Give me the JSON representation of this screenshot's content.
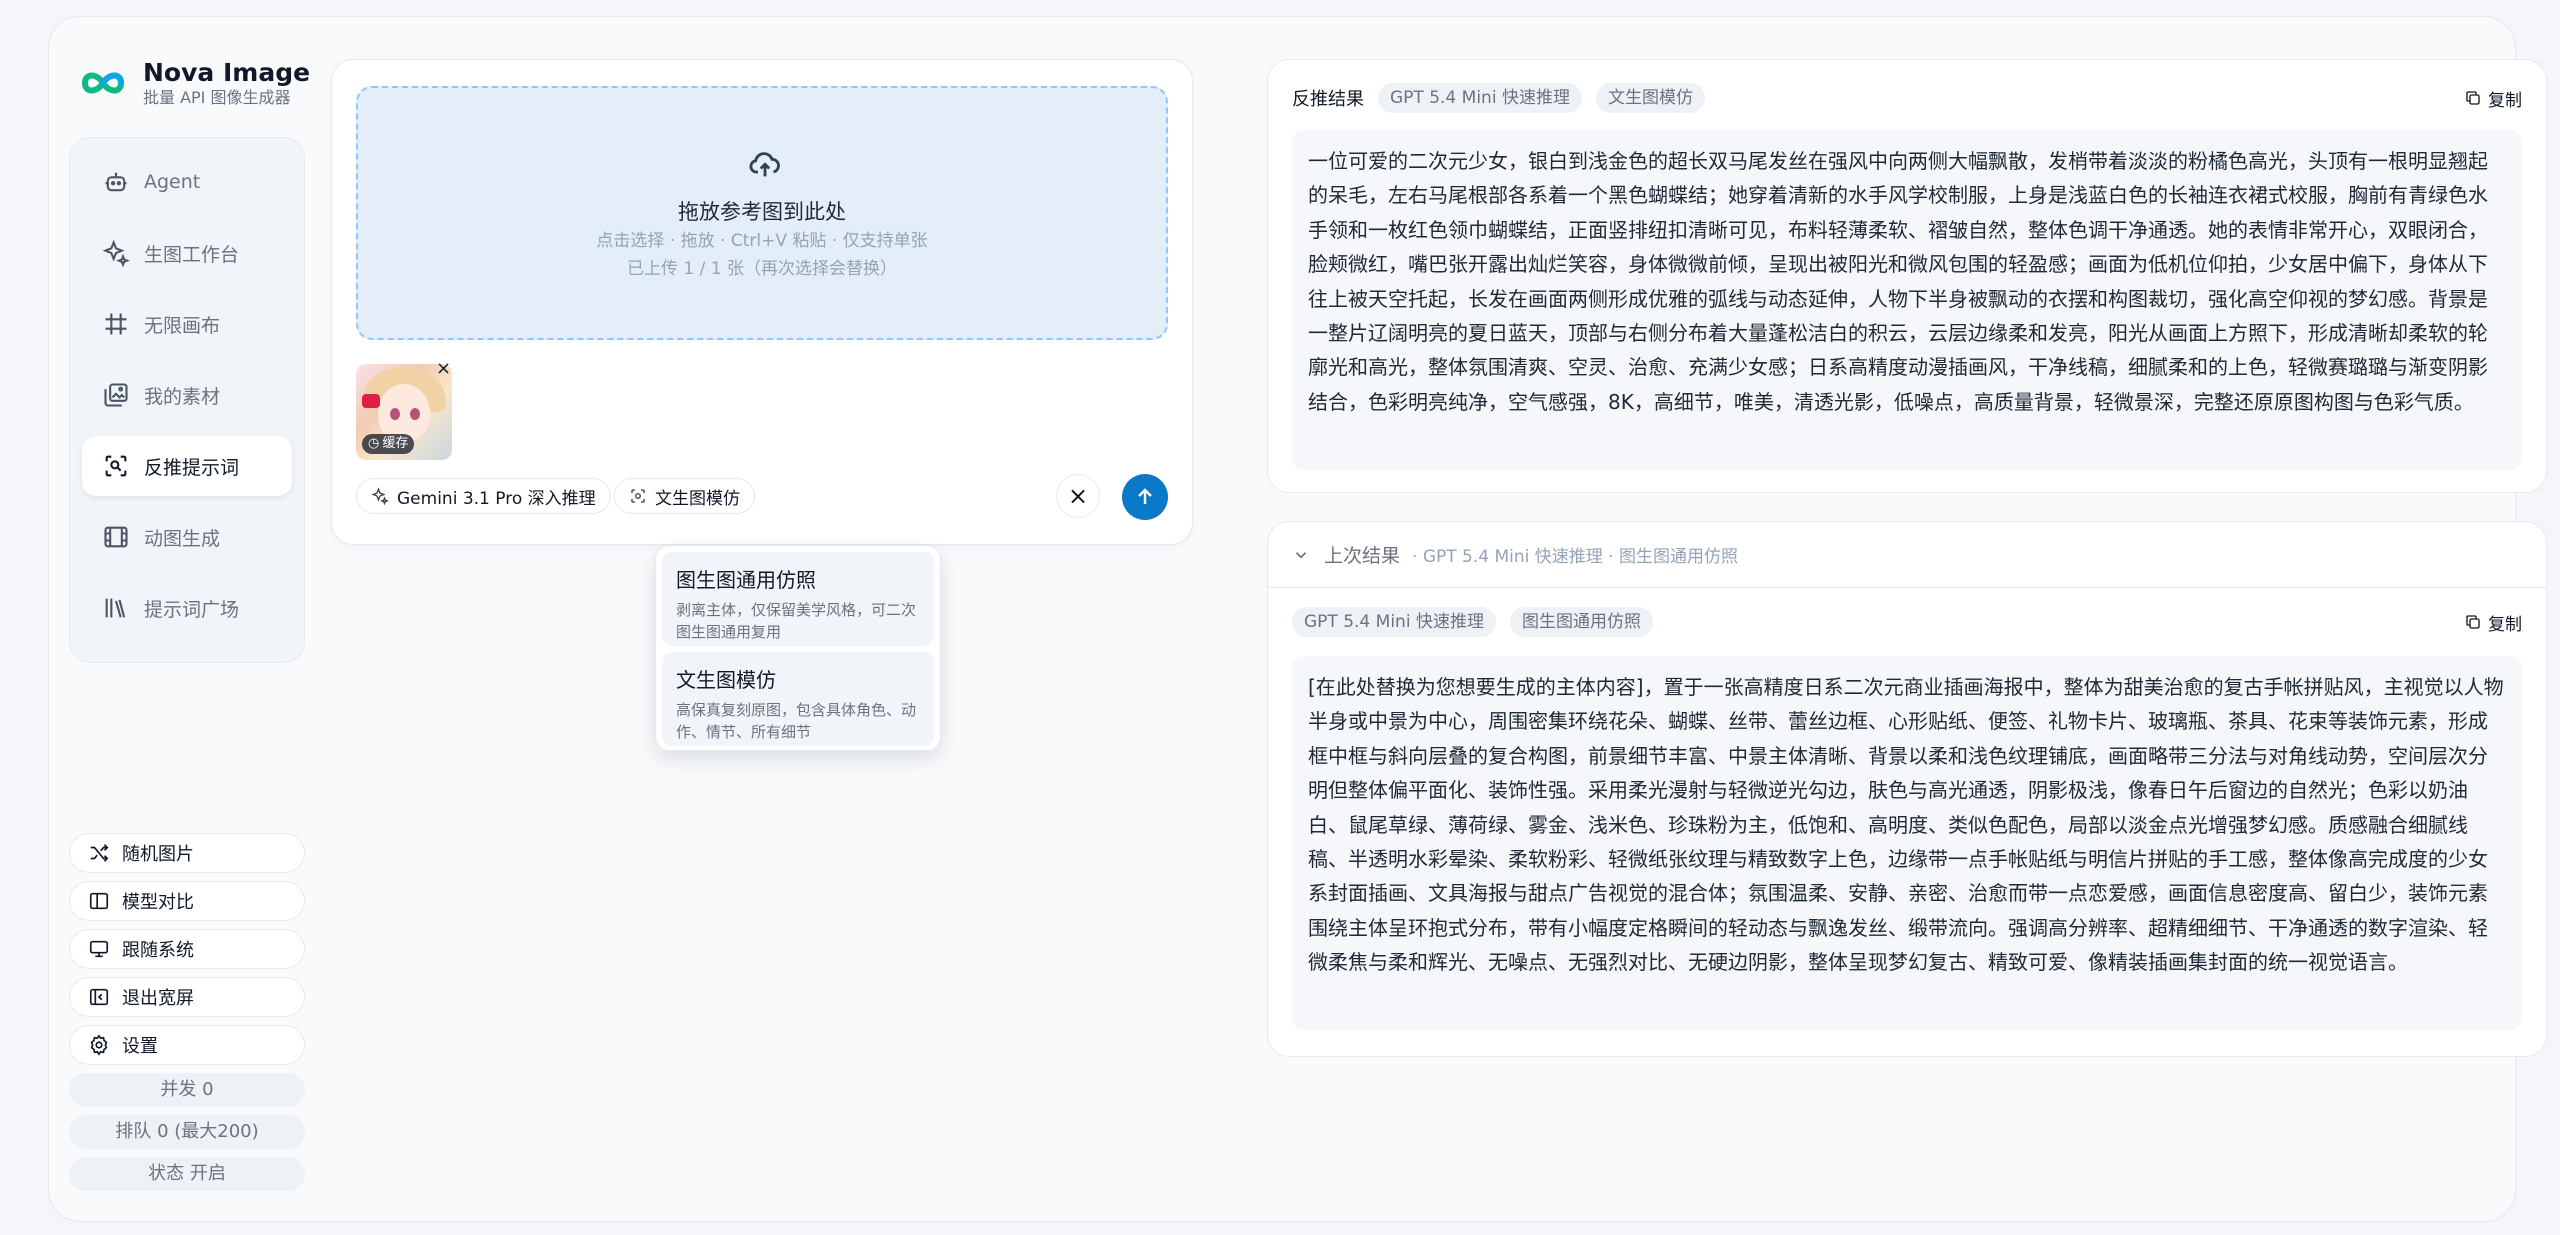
{
  "brand": {
    "name": "Nova Image",
    "subtitle": "批量 API 图像生成器"
  },
  "nav": [
    {
      "label": "Agent",
      "icon": "robot-icon"
    },
    {
      "label": "生图工作台",
      "icon": "sparkle-icon"
    },
    {
      "label": "无限画布",
      "icon": "canvas-icon"
    },
    {
      "label": "我的素材",
      "icon": "gallery-icon"
    },
    {
      "label": "反推提示词",
      "icon": "scan-icon",
      "active": true
    },
    {
      "label": "动图生成",
      "icon": "film-icon"
    },
    {
      "label": "提示词广场",
      "icon": "library-icon"
    }
  ],
  "bottom": {
    "random": "随机图片",
    "compare": "模型对比",
    "system": "跟随系统",
    "exit_wide": "退出宽屏",
    "settings": "设置"
  },
  "stats": {
    "concurrency": "并发 0",
    "queue": "排队 0 (最大200)",
    "status": "状态 开启"
  },
  "upload": {
    "title": "拖放参考图到此处",
    "hint": "点击选择 · 拖放 · Ctrl+V 粘贴 · 仅支持单张",
    "count": "已上传 1 / 1 张（再次选择会替换）",
    "thumb_badge": "缓存",
    "close_glyph": "×"
  },
  "chips": {
    "model": "Gemini 3.1 Pro 深入推理",
    "mode": "文生图模仿"
  },
  "actions": {
    "clear_glyph": "×"
  },
  "dropdown": [
    {
      "title": "图生图通用仿照",
      "desc": "剥离主体，仅保留美学风格，可二次图生图通用复用"
    },
    {
      "title": "文生图模仿",
      "desc": "高保真复刻原图，包含具体角色、动作、情节、所有细节"
    }
  ],
  "result": {
    "label": "反推结果",
    "tags": [
      "GPT 5.4 Mini 快速推理",
      "文生图模仿"
    ],
    "copy": "复制",
    "text": "一位可爱的二次元少女，银白到浅金色的超长双马尾发丝在强风中向两侧大幅飘散，发梢带着淡淡的粉橘色高光，头顶有一根明显翘起的呆毛，左右马尾根部各系着一个黑色蝴蝶结；她穿着清新的水手风学校制服，上身是浅蓝白色的长袖连衣裙式校服，胸前有青绿色水手领和一枚红色领巾蝴蝶结，正面竖排纽扣清晰可见，布料轻薄柔软、褶皱自然，整体色调干净通透。她的表情非常开心，双眼闭合，脸颊微红，嘴巴张开露出灿烂笑容，身体微微前倾，呈现出被阳光和微风包围的轻盈感；画面为低机位仰拍，少女居中偏下，身体从下往上被天空托起，长发在画面两侧形成优雅的弧线与动态延伸，人物下半身被飘动的衣摆和构图裁切，强化高空仰视的梦幻感。背景是一整片辽阔明亮的夏日蓝天，顶部与右侧分布着大量蓬松洁白的积云，云层边缘柔和发亮，阳光从画面上方照下，形成清晰却柔软的轮廓光和高光，整体氛围清爽、空灵、治愈、充满少女感；日系高精度动漫插画风，干净线稿，细腻柔和的上色，轻微赛璐璐与渐变阴影结合，色彩明亮纯净，空气感强，8K，高细节，唯美，清透光影，低噪点，高质量背景，轻微景深，完整还原原图构图与色彩气质。"
  },
  "previous": {
    "title": "上次结果",
    "meta": "· GPT 5.4 Mini 快速推理 · 图生图通用仿照",
    "tags": [
      "GPT 5.4 Mini 快速推理",
      "图生图通用仿照"
    ],
    "copy": "复制",
    "text": "[在此处替换为您想要生成的主体内容]，置于一张高精度日系二次元商业插画海报中，整体为甜美治愈的复古手帐拼贴风，主视觉以人物半身或中景为中心，周围密集环绕花朵、蝴蝶、丝带、蕾丝边框、心形贴纸、便签、礼物卡片、玻璃瓶、茶具、花束等装饰元素，形成框中框与斜向层叠的复合构图，前景细节丰富、中景主体清晰、背景以柔和浅色纹理铺底，画面略带三分法与对角线动势，空间层次分明但整体偏平面化、装饰性强。采用柔光漫射与轻微逆光勾边，肤色与高光通透，阴影极浅，像春日午后窗边的自然光；色彩以奶油白、鼠尾草绿、薄荷绿、雾金、浅米色、珍珠粉为主，低饱和、高明度、类似色配色，局部以淡金点光增强梦幻感。质感融合细腻线稿、半透明水彩晕染、柔软粉彩、轻微纸张纹理与精致数字上色，边缘带一点手帐贴纸与明信片拼贴的手工感，整体像高完成度的少女系封面插画、文具海报与甜点广告视觉的混合体；氛围温柔、安静、亲密、治愈而带一点恋爱感，画面信息密度高、留白少，装饰元素围绕主体呈环抱式分布，带有小幅度定格瞬间的轻动态与飘逸发丝、缎带流向。强调高分辨率、超精细细节、干净通透的数字渲染、轻微柔焦与柔和辉光、无噪点、无强烈对比、无硬边阴影，整体呈现梦幻复古、精致可爱、像精装插画集封面的统一视觉语言。"
  }
}
